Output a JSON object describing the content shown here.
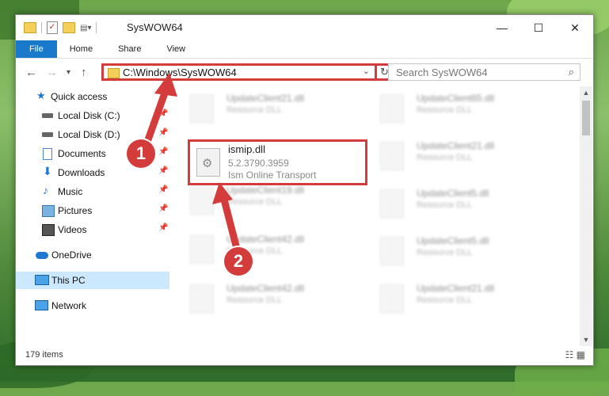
{
  "window": {
    "title": "SysWOW64",
    "controls": {
      "minimize": "—",
      "maximize": "☐",
      "close": "✕"
    }
  },
  "ribbon": {
    "tabs": [
      "File",
      "Home",
      "Share",
      "View"
    ]
  },
  "address_bar": {
    "path": "C:\\Windows\\SysWOW64",
    "dropdown_icon": "chevron-down-icon",
    "refresh_icon": "refresh-icon"
  },
  "search": {
    "placeholder": "Search SysWOW64",
    "icon": "search-icon"
  },
  "nav_pane": {
    "items": [
      {
        "label": "Quick access",
        "pinned": false
      },
      {
        "label": "Local Disk (C:)",
        "pinned": true
      },
      {
        "label": "Local Disk (D:)",
        "pinned": true
      },
      {
        "label": "Documents",
        "pinned": true
      },
      {
        "label": "Downloads",
        "pinned": true
      },
      {
        "label": "Music",
        "pinned": true
      },
      {
        "label": "Pictures",
        "pinned": true
      },
      {
        "label": "Videos",
        "pinned": true
      },
      {
        "label": "OneDrive",
        "pinned": false
      },
      {
        "label": "This PC",
        "pinned": false,
        "selected": true
      },
      {
        "label": "Network",
        "pinned": false
      }
    ]
  },
  "files": {
    "left_column": [
      {
        "name": "UpdateClient21.dll",
        "desc": "Resource DLL"
      },
      {
        "name": "ismip.dll",
        "version": "5.2.3790.3959",
        "desc": "Ism Online Transport",
        "highlighted": true
      },
      {
        "name": "UpdateClient19.dll",
        "desc": "Resource DLL"
      },
      {
        "name": "UpdateClient42.dll",
        "desc": "Resource DLL"
      },
      {
        "name": "UpdateClient42.dll",
        "desc": "Resource DLL"
      }
    ],
    "right_column": [
      {
        "name": "UpdateClient65.dll",
        "desc": "Resource DLL"
      },
      {
        "name": "UpdateClient21.dll",
        "desc": "Resource DLL"
      },
      {
        "name": "UpdateClient5.dll",
        "desc": "Resource DLL"
      },
      {
        "name": "UpdateClient5.dll",
        "desc": "Resource DLL"
      },
      {
        "name": "UpdateClient21.dll",
        "desc": "Resource DLL"
      }
    ]
  },
  "status_bar": {
    "item_count": "179 items"
  },
  "annotations": {
    "step1": "1",
    "step2": "2",
    "color": "#d43c3c"
  }
}
